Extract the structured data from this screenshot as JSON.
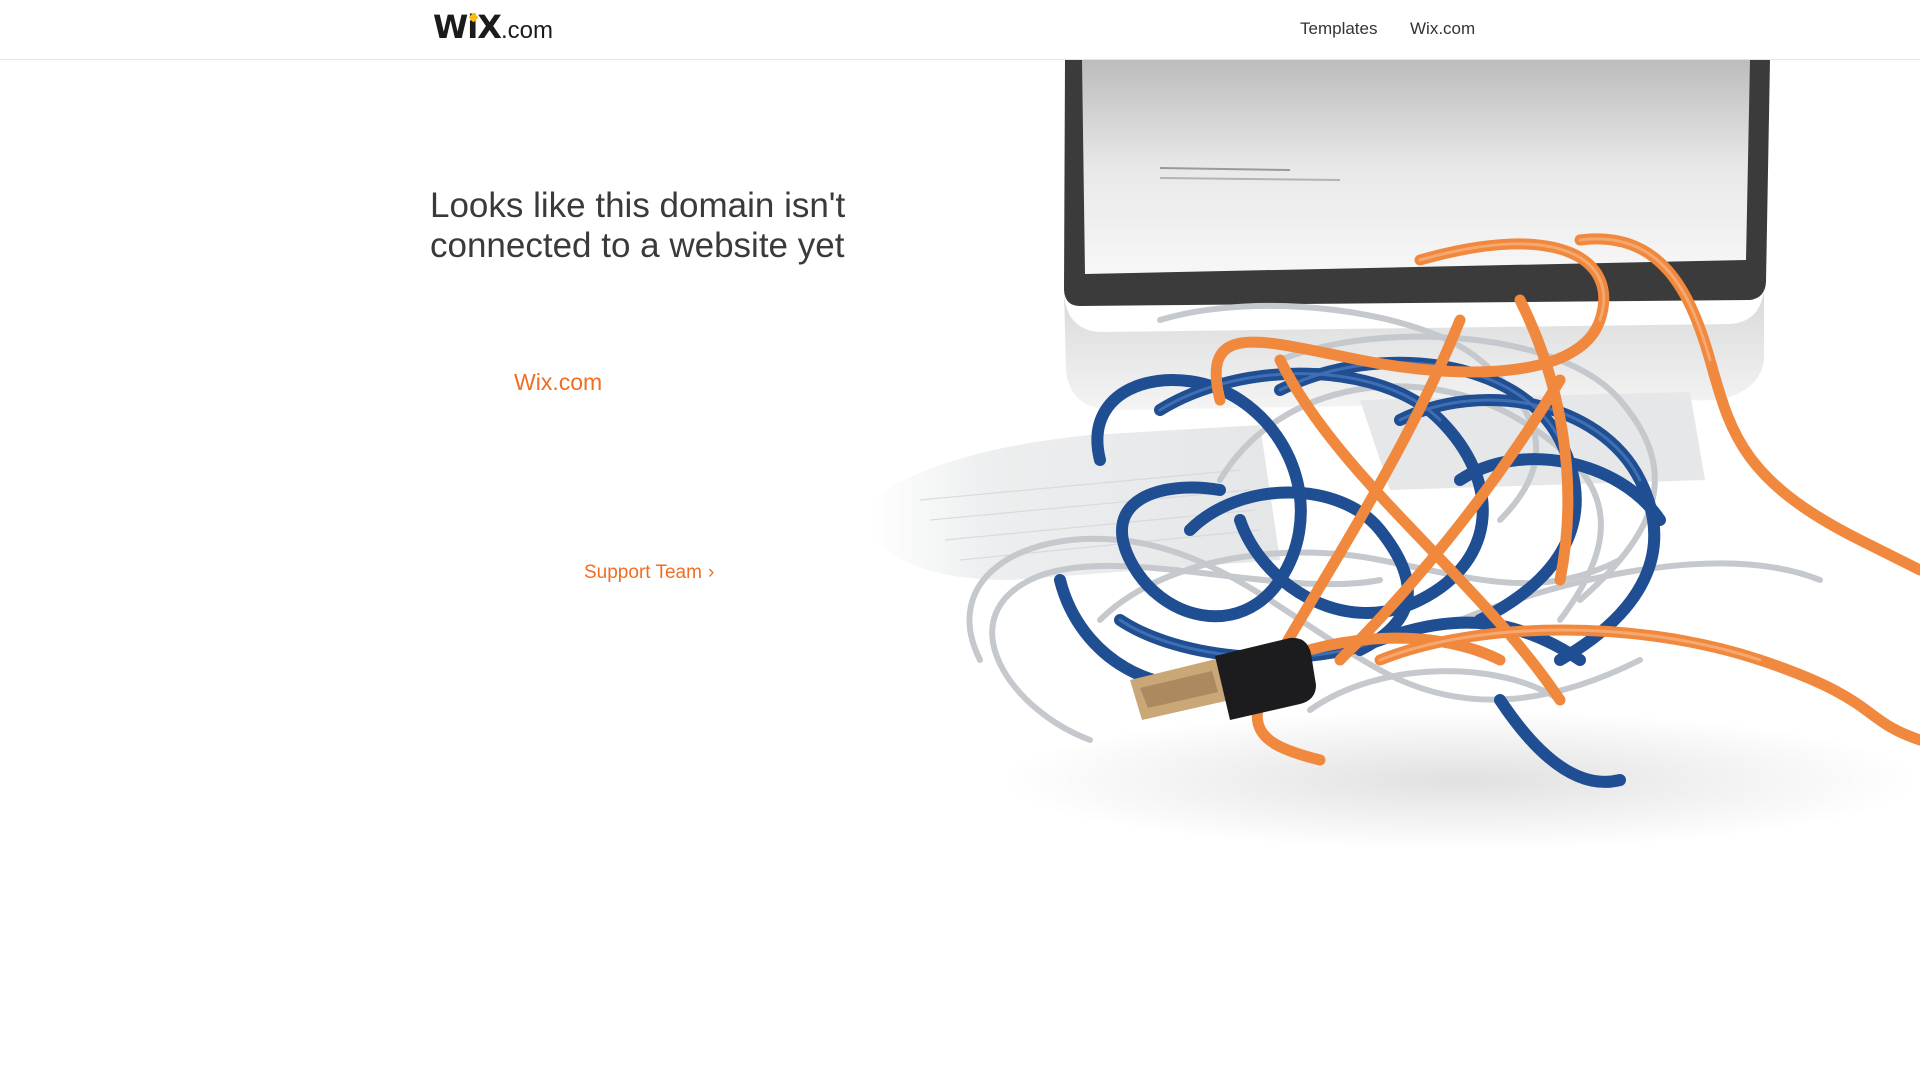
{
  "header": {
    "logo": {
      "mark": "WiX",
      "suffix": ".com"
    },
    "nav": [
      {
        "label": "Templates"
      },
      {
        "label": "Wix.com"
      }
    ]
  },
  "main": {
    "headline_line1": "Looks like this domain isn't",
    "headline_line2": "connected to a website yet",
    "brand_link": "Wix.com",
    "support_link": "Support Team",
    "support_chevron": "›"
  },
  "illustration": {
    "subject": "tangled-cables-with-computer-monitor",
    "monitor_text": "",
    "colors": {
      "orange_cable": "#f0883e",
      "blue_cable": "#234e92",
      "silver_cable": "#c8ccd0",
      "accent": "#f26d21"
    }
  }
}
